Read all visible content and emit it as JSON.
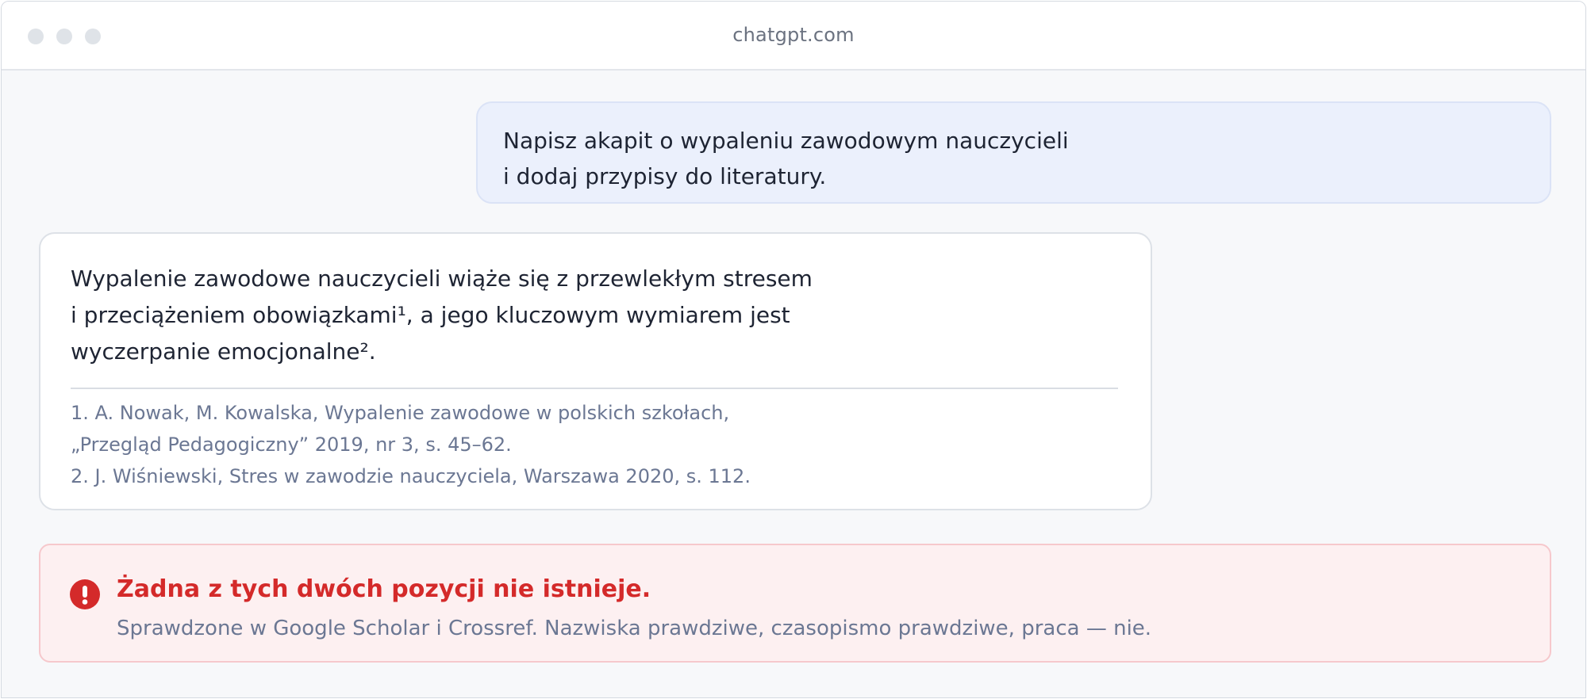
{
  "browser": {
    "url": "chatgpt.com"
  },
  "user_message": {
    "line1": "Napisz akapit o wypaleniu zawodowym nauczycieli",
    "line2": "i dodaj przypisy do literatury."
  },
  "assistant_message": {
    "line1": "Wypalenie zawodowe nauczycieli wiąże się z przewlekłym stresem",
    "line2": "i przeciążeniem obowiązkami¹, a jego kluczowym wymiarem jest",
    "line3": "wyczerpanie emocjonalne².",
    "footnotes": [
      "1. A. Nowak, M. Kowalska, Wypalenie zawodowe w polskich szkołach,",
      "„Przegląd Pedagogiczny” 2019, nr 3, s. 45–62.",
      "2. J. Wiśniewski, Stres w zawodzie nauczyciela, Warszawa 2020, s. 112."
    ]
  },
  "alert": {
    "icon": "exclamation-circle-icon",
    "color": "#d42a2a",
    "title": "Żadna z tych dwóch pozycji nie istnieje.",
    "description": "Sprawdzone w Google Scholar i Crossref. Nazwiska prawdziwe, czasopismo prawdziwe, praca — nie."
  }
}
